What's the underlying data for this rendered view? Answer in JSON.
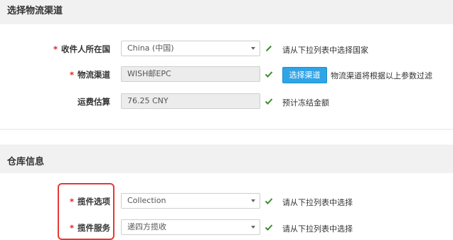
{
  "sections": {
    "logistics_title": "选择物流渠道",
    "warehouse_title": "仓库信息"
  },
  "logistics": {
    "country": {
      "label": "收件人所在国",
      "value": "China (中国)",
      "hint": "请从下拉列表中选择国家"
    },
    "channel": {
      "label": "物流渠道",
      "value": "WISH邮EPC",
      "button": "选择渠道",
      "hint": "物流渠道将根据以上参数过滤"
    },
    "fee": {
      "label": "运费估算",
      "value": "76.25 CNY",
      "hint": "预计冻结金额"
    }
  },
  "warehouse": {
    "pickup_option": {
      "label": "揽件选项",
      "value": "Collection",
      "hint": "请从下拉列表中选择"
    },
    "pickup_service": {
      "label": "揽件服务",
      "value": "递四方揽收",
      "hint": "请从下拉列表中选择"
    }
  },
  "required_mark": "*",
  "colors": {
    "required": "#e02020",
    "check": "#3c8d2f",
    "button": "#2fa4e7",
    "highlight": "#e53935"
  },
  "icons": {
    "edit": "pencil-icon",
    "valid": "check-icon"
  }
}
